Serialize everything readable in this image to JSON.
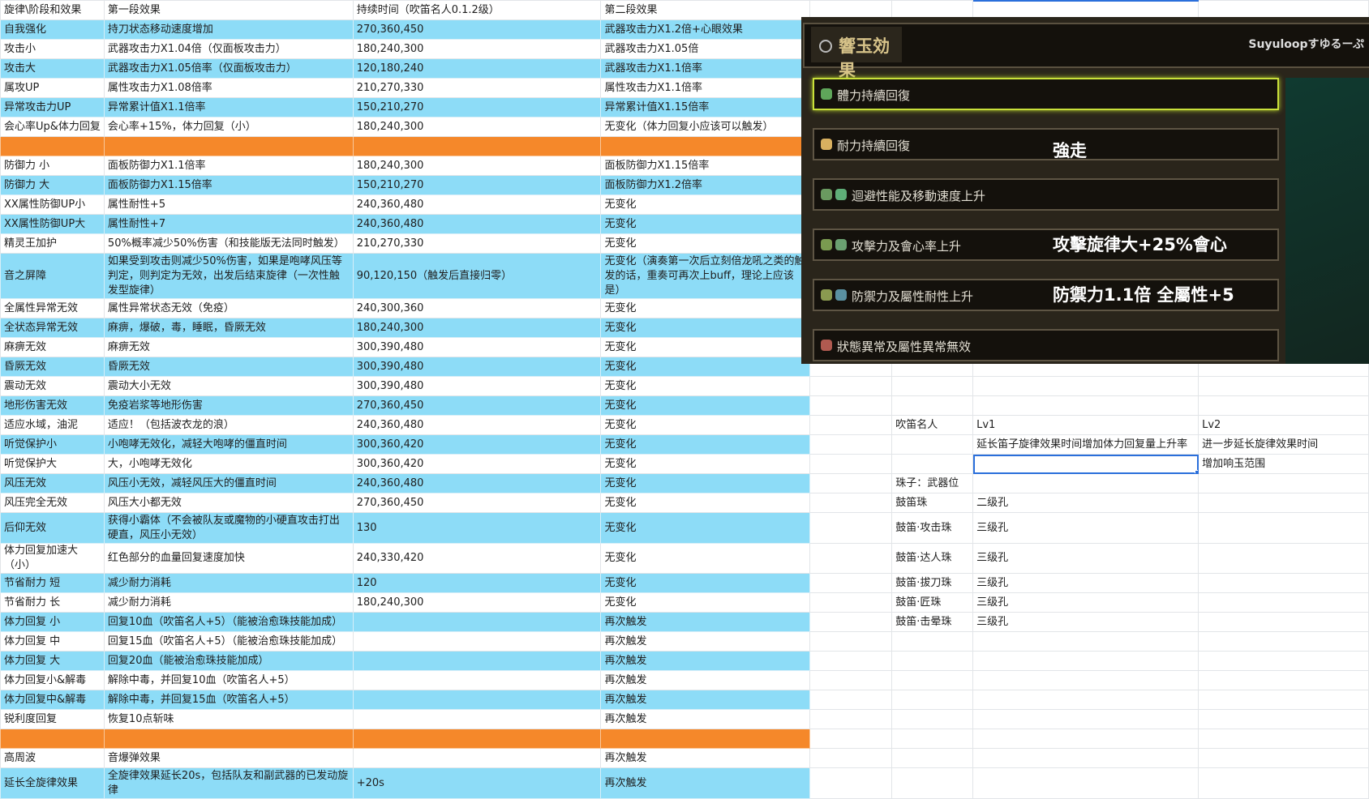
{
  "sheet": {
    "columns": [
      "旋律\\阶段和效果",
      "第一段效果",
      "持续时间（吹笛名人0.1.2级）",
      "第二段效果"
    ],
    "rows": [
      {
        "style": "blue",
        "cells": [
          "自我强化",
          "持刀状态移动速度增加",
          "270,360,450",
          "武器攻击力X1.2倍+心眼效果"
        ]
      },
      {
        "style": "white",
        "cells": [
          "攻击小",
          "武器攻击力X1.04倍（仅面板攻击力）",
          "180,240,300",
          "武器攻击力X1.05倍"
        ]
      },
      {
        "style": "blue",
        "cells": [
          "攻击大",
          "武器攻击力X1.05倍率（仅面板攻击力）",
          "120,180,240",
          "武器攻击力X1.1倍率"
        ]
      },
      {
        "style": "white",
        "cells": [
          "属攻UP",
          "属性攻击力X1.08倍率",
          "210,270,330",
          "属性攻击力X1.1倍率"
        ]
      },
      {
        "style": "blue",
        "cells": [
          "异常攻击力UP",
          "异常累计值X1.1倍率",
          "150,210,270",
          "异常累计值X1.15倍率"
        ]
      },
      {
        "style": "white",
        "cells": [
          "会心率Up&体力回复",
          "会心率+15%，体力回复（小）",
          "180,240,300",
          "无变化（体力回复小应该可以触发）"
        ]
      },
      {
        "style": "orange",
        "cells": [
          "",
          "",
          "",
          ""
        ]
      },
      {
        "style": "white",
        "cells": [
          "防御力 小",
          "面板防御力X1.1倍率",
          "180,240,300",
          "面板防御力X1.15倍率"
        ]
      },
      {
        "style": "blue",
        "cells": [
          "防御力 大",
          "面板防御力X1.15倍率",
          "150,210,270",
          "面板防御力X1.2倍率"
        ]
      },
      {
        "style": "white",
        "cells": [
          "XX属性防御UP小",
          "属性耐性+5",
          "240,360,480",
          "无变化"
        ]
      },
      {
        "style": "blue",
        "cells": [
          "XX属性防御UP大",
          "属性耐性+7",
          "240,360,480",
          "无变化"
        ]
      },
      {
        "style": "white",
        "cells": [
          "精灵王加护",
          "50%概率减少50%伤害（和技能版无法同时触发）",
          "210,270,330",
          "无变化"
        ]
      },
      {
        "style": "blue",
        "tall": "xl",
        "cells": [
          "音之屏障",
          "如果受到攻击则减少50%伤害，如果是咆哮风压等判定，则判定为无效，出发后结束旋律（一次性触发型旋律）",
          "90,120,150（触发后直接归零）",
          "无变化（演奏第一次后立刻倍龙吼之类的触发的话，重奏可再次上buff，理论上应该是）"
        ]
      },
      {
        "style": "white",
        "cells": [
          "全属性异常无效",
          "属性异常状态无效（免疫）",
          "240,300,360",
          "无变化"
        ]
      },
      {
        "style": "blue",
        "cells": [
          "全状态异常无效",
          "麻痹，爆破，毒，睡眠，昏厥无效",
          "180,240,300",
          "无变化"
        ]
      },
      {
        "style": "white",
        "cells": [
          "麻痹无效",
          "麻痹无效",
          "300,390,480",
          "无变化"
        ]
      },
      {
        "style": "blue",
        "cells": [
          "昏厥无效",
          "昏厥无效",
          "300,390,480",
          "无变化"
        ]
      },
      {
        "style": "white",
        "cells": [
          "震动无效",
          "震动大小无效",
          "300,390,480",
          "无变化"
        ]
      },
      {
        "style": "blue",
        "cells": [
          "地形伤害无效",
          "免疫岩浆等地形伤害",
          "270,360,450",
          "无变化"
        ]
      },
      {
        "style": "white",
        "cells": [
          "适应水域，油泥",
          "适应！（包括波衣龙的浪）",
          "240,360,480",
          "无变化"
        ]
      },
      {
        "style": "blue",
        "cells": [
          "听觉保护小",
          "小咆哮无效化，减轻大咆哮的僵直时间",
          "300,360,420",
          "无变化"
        ]
      },
      {
        "style": "white",
        "cells": [
          "听觉保护大",
          "大，小咆哮无效化",
          "300,360,420",
          "无变化"
        ]
      },
      {
        "style": "blue",
        "cells": [
          "风压无效",
          "风压小无效，减轻风压大的僵直时间",
          "240,360,480",
          "无变化"
        ]
      },
      {
        "style": "white",
        "cells": [
          "风压完全无效",
          "风压大小都无效",
          "270,360,450",
          "无变化"
        ]
      },
      {
        "style": "blue",
        "tall": "l",
        "cells": [
          "后仰无效",
          "获得小霸体（不会被队友或魔物的小硬直攻击打出硬直，风压小无效）",
          "130",
          "无变化"
        ]
      },
      {
        "style": "white",
        "cells": [
          "体力回复加速大（小）",
          "红色部分的血量回复速度加快",
          "240,330,420",
          "无变化"
        ]
      },
      {
        "style": "blue",
        "cells": [
          "节省耐力 短",
          "减少耐力消耗",
          "120",
          "无变化"
        ]
      },
      {
        "style": "white",
        "cells": [
          "节省耐力 长",
          "减少耐力消耗",
          "180,240,300",
          "无变化"
        ]
      },
      {
        "style": "blue",
        "cells": [
          "体力回复 小",
          "回复10血（吹笛名人+5）（能被治愈珠技能加成）",
          "",
          "再次触发"
        ]
      },
      {
        "style": "white",
        "cells": [
          "体力回复 中",
          "回复15血（吹笛名人+5）（能被治愈珠技能加成）",
          "",
          "再次触发"
        ]
      },
      {
        "style": "blue",
        "cells": [
          "体力回复 大",
          "回复20血（能被治愈珠技能加成）",
          "",
          "再次触发"
        ]
      },
      {
        "style": "white",
        "cells": [
          "体力回复小&解毒",
          "解除中毒，并回复10血（吹笛名人+5）",
          "",
          "再次触发"
        ]
      },
      {
        "style": "blue",
        "cells": [
          "体力回复中&解毒",
          "解除中毒，并回复15血（吹笛名人+5）",
          "",
          "再次触发"
        ]
      },
      {
        "style": "white",
        "cells": [
          "锐利度回复",
          "恢复10点斩味",
          "",
          "再次触发"
        ]
      },
      {
        "style": "orange",
        "cells": [
          "",
          "",
          "",
          ""
        ]
      },
      {
        "style": "white",
        "cells": [
          "高周波",
          "音爆弹效果",
          "",
          "再次触发"
        ]
      },
      {
        "style": "blue",
        "tall": "l",
        "cells": [
          "延长全旋律效果",
          "全旋律效果延长20s，包括队友和副武器的已发动旋律",
          "+20s",
          "再次触发"
        ]
      }
    ],
    "side_rows": [
      {
        "row": 20,
        "cells": [
          "",
          "吹笛名人",
          "Lv1",
          "Lv2"
        ]
      },
      {
        "row": 21,
        "cells": [
          "",
          "",
          "延长笛子旋律效果时间增加体力回复量上升率",
          "进一步延长旋律效果时间"
        ]
      },
      {
        "row": 22,
        "cells": [
          "",
          "",
          "",
          "增加响玉范围"
        ],
        "selected_col": 2
      },
      {
        "row": 23,
        "cells": [
          "",
          "珠子：武器位",
          "",
          ""
        ]
      },
      {
        "row": 24,
        "cells": [
          "",
          "鼓笛珠",
          "二级孔",
          ""
        ]
      },
      {
        "row": 25,
        "cells": [
          "",
          "鼓笛·攻击珠",
          "三级孔",
          ""
        ]
      },
      {
        "row": 26,
        "cells": [
          "",
          "鼓笛·达人珠",
          "三级孔",
          ""
        ]
      },
      {
        "row": 27,
        "cells": [
          "",
          "鼓笛·拔刀珠",
          "三级孔",
          ""
        ]
      },
      {
        "row": 28,
        "cells": [
          "",
          "鼓笛·匠珠",
          "三级孔",
          ""
        ]
      },
      {
        "row": 29,
        "cells": [
          "",
          "鼓笛·击晕珠",
          "三级孔",
          ""
        ]
      }
    ]
  },
  "overlay": {
    "title": "響玉効果",
    "credit": "Suyuloopすゆるーぷ",
    "items": [
      {
        "label": "體力持續回復",
        "note": "",
        "active": true,
        "icon_colors": [
          "#5fa65a"
        ]
      },
      {
        "label": "耐力持續回復",
        "note": "強走",
        "active": false,
        "icon_colors": [
          "#d8b060"
        ]
      },
      {
        "label": "迴避性能及移動速度上升",
        "note": "",
        "active": false,
        "icon_colors": [
          "#6a9a60",
          "#5fae78"
        ]
      },
      {
        "label": "攻擊力及會心率上升",
        "note": "攻擊旋律大+25%會心",
        "active": false,
        "icon_colors": [
          "#7a9a50",
          "#6aa070"
        ]
      },
      {
        "label": "防禦力及屬性耐性上升",
        "note": "防禦力1.1倍 全屬性+5",
        "active": false,
        "icon_colors": [
          "#8a9a50",
          "#5a90a0"
        ]
      },
      {
        "label": "狀態異常及屬性異常無效",
        "note": "",
        "active": false,
        "icon_colors": [
          "#b05a50"
        ]
      }
    ]
  },
  "colors": {
    "blue": "#8ddcf7",
    "orange": "#f5882a",
    "selection": "#2a6fdb"
  }
}
